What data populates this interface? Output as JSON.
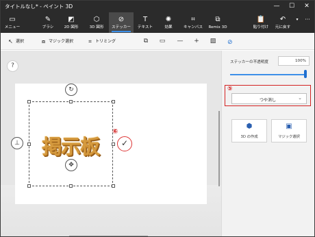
{
  "window": {
    "title": "タイトルなし* - ペイント 3D",
    "min_label": "—",
    "max_label": "☐",
    "close_label": "✕"
  },
  "ribbon": {
    "items": [
      {
        "label": "メニュー",
        "icon": "menu-icon",
        "active": false
      },
      {
        "label": "ブラシ",
        "icon": "brush-icon",
        "active": false
      },
      {
        "label": "2D 図形",
        "icon": "shapes-2d-icon",
        "active": false
      },
      {
        "label": "3D 図形",
        "icon": "cube-icon",
        "active": false
      },
      {
        "label": "ステッカー",
        "icon": "sticker-icon",
        "active": true
      },
      {
        "label": "テキスト",
        "icon": "text-icon",
        "active": false
      },
      {
        "label": "効果",
        "icon": "effects-icon",
        "active": false
      },
      {
        "label": "キャンバス",
        "icon": "canvas-icon",
        "active": false
      },
      {
        "label": "Remix 3D",
        "icon": "remix-icon",
        "active": false
      },
      {
        "label": "貼り付け",
        "icon": "paste-icon",
        "active": false
      },
      {
        "label": "元に戻す",
        "icon": "undo-icon",
        "active": false
      }
    ],
    "more_label": "···"
  },
  "toolbar": {
    "select_label": "選択",
    "magic_select_label": "マジック選択",
    "crop_label": "トリミング",
    "minus": "—",
    "plus": "+"
  },
  "canvas": {
    "help_label": "?",
    "sticker_text": "掲示板"
  },
  "annotations": {
    "five": "⑤",
    "six": "⑥"
  },
  "panel": {
    "opacity_label": "ステッカーの不透明度",
    "opacity_value": "100%",
    "opacity_fraction": 1.0,
    "finish_selected": "つや消し",
    "make_3d_label": "3D の作成",
    "magic_select_label": "マジック選択"
  },
  "colors": {
    "accent": "#3c8fe8",
    "annotation": "#d32020",
    "sticker": "#d59a3e"
  }
}
